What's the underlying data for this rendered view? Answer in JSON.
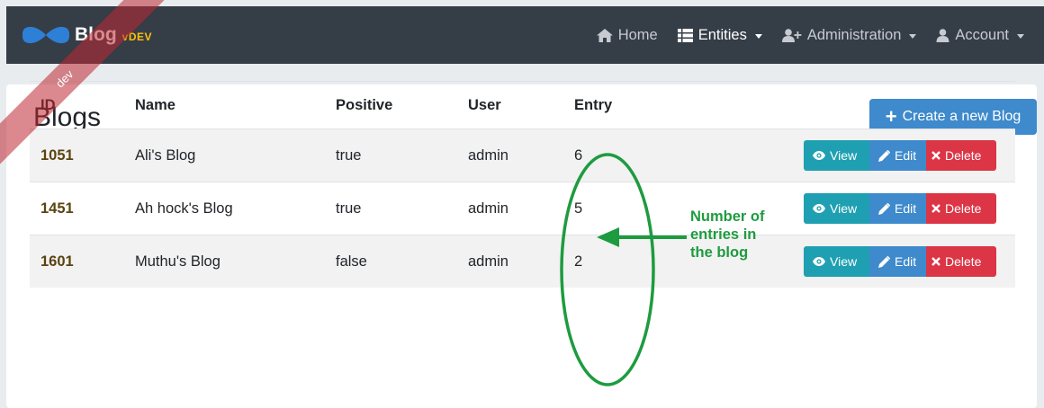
{
  "navbar": {
    "brand_title": "Blog",
    "brand_version": "vDEV",
    "ribbon": "dev",
    "items": [
      {
        "label": "Home",
        "icon": "home-icon"
      },
      {
        "label": "Entities",
        "icon": "list-icon",
        "active": true
      },
      {
        "label": "Administration",
        "icon": "user-plus-icon"
      },
      {
        "label": "Account",
        "icon": "user-icon"
      }
    ]
  },
  "page": {
    "title": "Blogs",
    "create_label": "Create a new Blog"
  },
  "table": {
    "headers": [
      "ID",
      "Name",
      "Positive",
      "User",
      "Entry"
    ],
    "rows": [
      {
        "id": "1051",
        "name": "Ali's Blog",
        "positive": "true",
        "user": "admin",
        "entry": "6"
      },
      {
        "id": "1451",
        "name": "Ah hock's Blog",
        "positive": "true",
        "user": "admin",
        "entry": "5"
      },
      {
        "id": "1601",
        "name": "Muthu's Blog",
        "positive": "false",
        "user": "admin",
        "entry": "2"
      }
    ],
    "actions": {
      "view": "View",
      "edit": "Edit",
      "delete": "Delete"
    }
  },
  "annotation": {
    "text": "Number of\nentries in\nthe blog",
    "color": "#1e9b3f"
  },
  "colors": {
    "navbar": "#353d47",
    "primary": "#3e8acc",
    "info": "#1fa0b2",
    "danger": "#dc3545",
    "version": "#ffc107"
  }
}
